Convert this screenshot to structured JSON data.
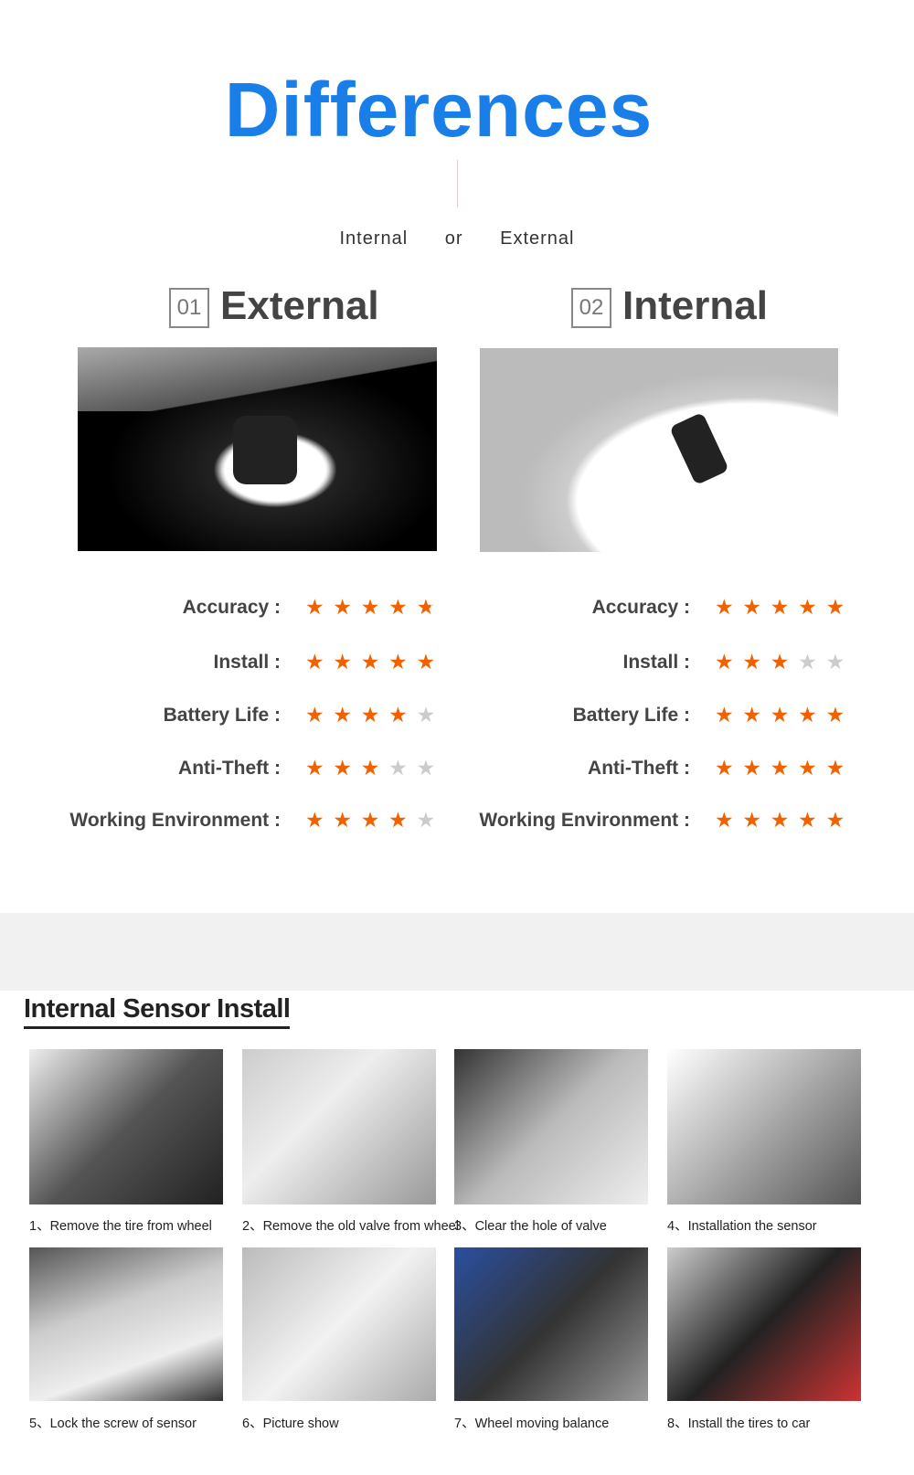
{
  "header": {
    "title": "Differences",
    "subtitle": {
      "left": "Internal",
      "middle": "or",
      "right": "External"
    }
  },
  "colors": {
    "accent": "#1a7ee8",
    "star_on": "#f26100",
    "star_off": "#cccccc"
  },
  "products": [
    {
      "number": "01",
      "name": "External",
      "ratings": [
        {
          "label": "Accuracy :",
          "stars": 4.5
        },
        {
          "label": "Install :",
          "stars": 5
        },
        {
          "label": "Battery Life :",
          "stars": 4
        },
        {
          "label": "Anti-Theft :",
          "stars": 3
        },
        {
          "label": "Working Environment :",
          "stars": 4
        }
      ]
    },
    {
      "number": "02",
      "name": "Internal",
      "ratings": [
        {
          "label": "Accuracy :",
          "stars": 5
        },
        {
          "label": "Install :",
          "stars": 3
        },
        {
          "label": "Battery Life :",
          "stars": 5
        },
        {
          "label": "Anti-Theft :",
          "stars": 5
        },
        {
          "label": "Working Environment :",
          "stars": 5
        }
      ]
    }
  ],
  "install": {
    "title": "Internal Sensor Install",
    "steps": [
      "1、Remove the tire from wheel",
      "2、Remove the old valve from wheel",
      "3、Clear the hole of valve",
      "4、Installation the sensor",
      "5、Lock the screw of sensor",
      "6、Picture show",
      "7、Wheel moving balance",
      "8、Install the tires to car"
    ]
  }
}
